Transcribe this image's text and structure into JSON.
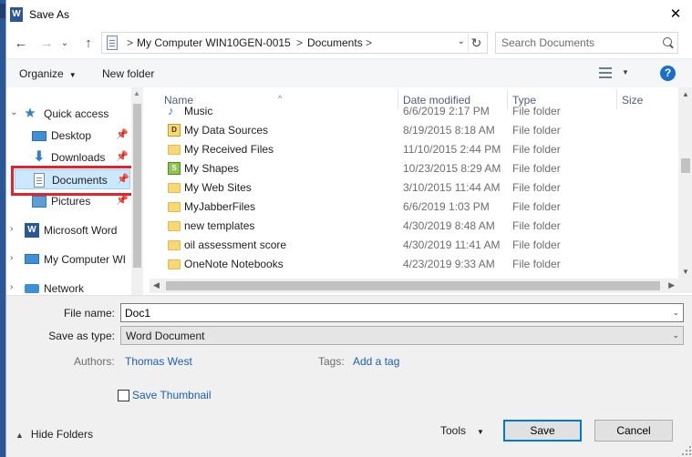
{
  "window": {
    "title": "Save As",
    "app_icon_letter": "W",
    "close_glyph": "✕"
  },
  "nav_buttons": {
    "back": "←",
    "forward": "→",
    "up": "↑"
  },
  "address": {
    "parts": [
      "My Computer WIN10GEN-0015",
      "Documents"
    ],
    "separator": ">"
  },
  "search": {
    "placeholder": "Search Documents"
  },
  "toolbar": {
    "organize": "Organize",
    "new_folder": "New folder",
    "help": "?"
  },
  "nav_pane": {
    "items": [
      {
        "label": "Quick access",
        "icon": "star-icon"
      },
      {
        "label": "Desktop",
        "icon": "desktop-icon",
        "pinned": true
      },
      {
        "label": "Downloads",
        "icon": "download-icon",
        "pinned": true
      },
      {
        "label": "Documents",
        "icon": "documents-icon",
        "pinned": true,
        "selected": true
      },
      {
        "label": "Pictures",
        "icon": "pictures-icon",
        "pinned": true
      },
      {
        "label": "Microsoft Word",
        "icon": "word-icon"
      },
      {
        "label": "My Computer WI",
        "icon": "computer-icon"
      },
      {
        "label": "Network",
        "icon": "network-icon"
      }
    ],
    "highlight_color": "#e4222c"
  },
  "file_list": {
    "columns": [
      "Name",
      "Date modified",
      "Type",
      "Size"
    ],
    "rows": [
      {
        "name": "Music",
        "date": "6/6/2019 2:17 PM",
        "type": "File folder",
        "icon": "music-folder-icon"
      },
      {
        "name": "My Data Sources",
        "date": "8/19/2015 8:18 AM",
        "type": "File folder",
        "icon": "data-sources-icon"
      },
      {
        "name": "My Received Files",
        "date": "11/10/2015 2:44 PM",
        "type": "File folder",
        "icon": "folder-icon"
      },
      {
        "name": "My Shapes",
        "date": "10/23/2015 8:29 AM",
        "type": "File folder",
        "icon": "shapes-icon"
      },
      {
        "name": "My Web Sites",
        "date": "3/10/2015 11:44 AM",
        "type": "File folder",
        "icon": "folder-icon"
      },
      {
        "name": "MyJabberFiles",
        "date": "6/6/2019 1:03 PM",
        "type": "File folder",
        "icon": "folder-icon"
      },
      {
        "name": "new templates",
        "date": "4/30/2019 8:48 AM",
        "type": "File folder",
        "icon": "folder-icon"
      },
      {
        "name": "oil assessment score",
        "date": "4/30/2019 11:41 AM",
        "type": "File folder",
        "icon": "folder-icon"
      },
      {
        "name": "OneNote Notebooks",
        "date": "4/23/2019 9:33 AM",
        "type": "File folder",
        "icon": "folder-icon"
      }
    ]
  },
  "form": {
    "file_name_label": "File name:",
    "file_name_value": "Doc1",
    "save_as_type_label": "Save as type:",
    "save_as_type_value": "Word Document",
    "authors_label": "Authors:",
    "authors_value": "Thomas West",
    "tags_label": "Tags:",
    "tags_value": "Add a tag",
    "save_thumbnail_label": "Save Thumbnail",
    "save_thumbnail_checked": false
  },
  "footer": {
    "hide_folders": "Hide Folders",
    "tools": "Tools",
    "save": "Save",
    "cancel": "Cancel"
  },
  "colors": {
    "accent": "#0078d7",
    "link": "#1c5fb0",
    "selection": "#cce8ff"
  }
}
